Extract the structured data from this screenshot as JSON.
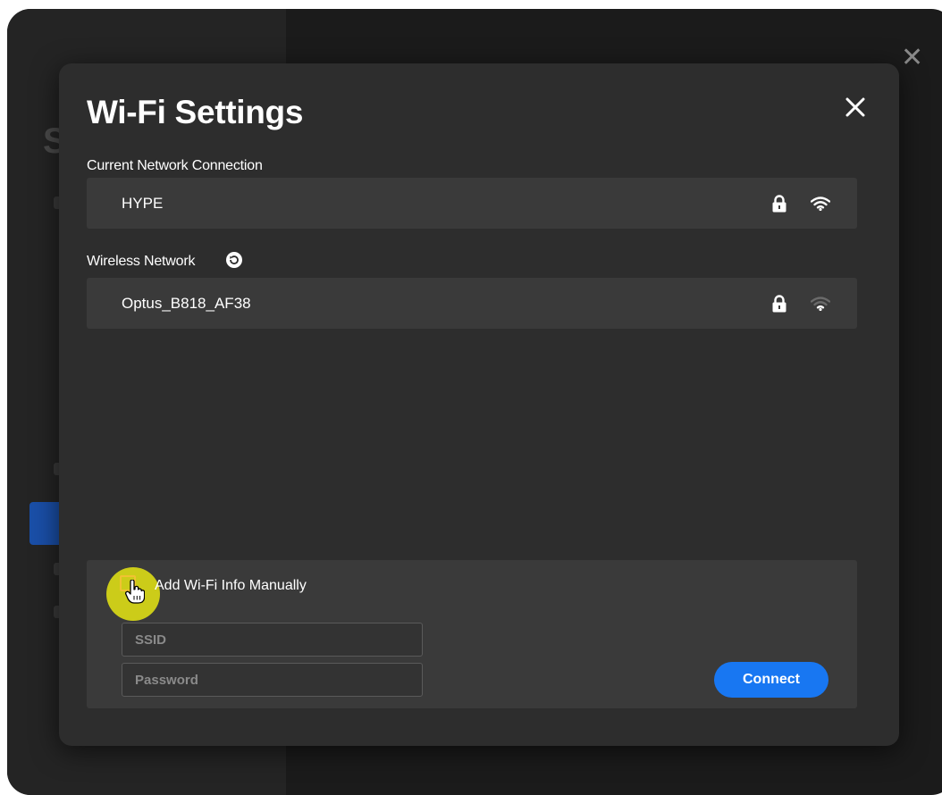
{
  "dialog": {
    "title": "Wi-Fi Settings"
  },
  "current_network": {
    "label": "Current Network Connection",
    "name": "HYPE",
    "secured": true,
    "signal": "strong"
  },
  "wireless_networks": {
    "label": "Wireless Network",
    "items": [
      {
        "name": "Optus_B818_AF38",
        "secured": true,
        "signal": "weak"
      }
    ]
  },
  "manual": {
    "label": "Add Wi-Fi Info Manually",
    "ssid_placeholder": "SSID",
    "password_placeholder": "Password",
    "connect_label": "Connect"
  },
  "colors": {
    "accent": "#1877f2",
    "dialog_bg": "#2d2d2d",
    "row_bg": "#3a3a3a",
    "checkbox_border": "#f1c232",
    "cursor_highlight": "#e6e614"
  },
  "icons": {
    "close": "close-icon",
    "lock": "lock-icon",
    "wifi": "wifi-icon",
    "refresh": "refresh-icon",
    "cursor": "hand-cursor-icon"
  }
}
